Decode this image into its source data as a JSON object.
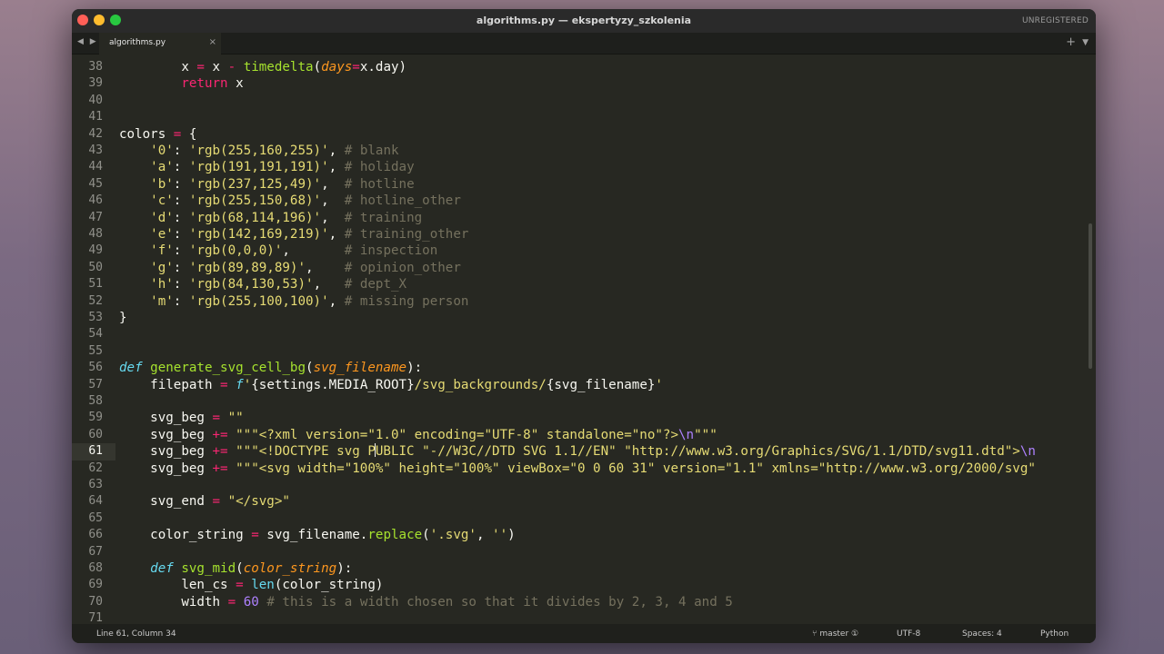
{
  "window": {
    "title": "algorithms.py — ekspertyzy_szkolenia",
    "unregistered": "UNREGISTERED"
  },
  "tabs": [
    {
      "label": "algorithms.py",
      "active": true
    }
  ],
  "tabbar": {
    "nav": "◀ ▶",
    "close": "×",
    "plus": "+",
    "menu": "▼"
  },
  "status": {
    "position": "Line 61, Column 34",
    "branch": "master",
    "branch_badge": "①",
    "encoding": "UTF-8",
    "indent": "Spaces: 4",
    "syntax": "Python"
  },
  "editor": {
    "current_line": 61,
    "lines": [
      {
        "n": "38",
        "t": [
          [
            "",
            "        x "
          ],
          [
            "kw",
            "="
          ],
          [
            "",
            " x "
          ],
          [
            "kw",
            "-"
          ],
          [
            "",
            " "
          ],
          [
            "fn",
            "timedelta"
          ],
          [
            "",
            "("
          ],
          [
            "prm",
            "days"
          ],
          [
            "kw",
            "="
          ],
          [
            "",
            "x.day)"
          ]
        ]
      },
      {
        "n": "39",
        "t": [
          [
            "",
            "        "
          ],
          [
            "kw",
            "return"
          ],
          [
            "",
            " x"
          ]
        ]
      },
      {
        "n": "40",
        "t": []
      },
      {
        "n": "41",
        "t": []
      },
      {
        "n": "42",
        "t": [
          [
            "",
            "colors "
          ],
          [
            "kw",
            "="
          ],
          [
            "",
            " {"
          ]
        ]
      },
      {
        "n": "43",
        "t": [
          [
            "",
            "    "
          ],
          [
            "str",
            "'0'"
          ],
          [
            "",
            ": "
          ],
          [
            "str",
            "'rgb(255,160,255)'"
          ],
          [
            "",
            ", "
          ],
          [
            "cmt",
            "# blank"
          ]
        ]
      },
      {
        "n": "44",
        "t": [
          [
            "",
            "    "
          ],
          [
            "str",
            "'a'"
          ],
          [
            "",
            ": "
          ],
          [
            "str",
            "'rgb(191,191,191)'"
          ],
          [
            "",
            ", "
          ],
          [
            "cmt",
            "# holiday"
          ]
        ]
      },
      {
        "n": "45",
        "t": [
          [
            "",
            "    "
          ],
          [
            "str",
            "'b'"
          ],
          [
            "",
            ": "
          ],
          [
            "str",
            "'rgb(237,125,49)'"
          ],
          [
            "",
            ",  "
          ],
          [
            "cmt",
            "# hotline"
          ]
        ]
      },
      {
        "n": "46",
        "t": [
          [
            "",
            "    "
          ],
          [
            "str",
            "'c'"
          ],
          [
            "",
            ": "
          ],
          [
            "str",
            "'rgb(255,150,68)'"
          ],
          [
            "",
            ",  "
          ],
          [
            "cmt",
            "# hotline_other"
          ]
        ]
      },
      {
        "n": "47",
        "t": [
          [
            "",
            "    "
          ],
          [
            "str",
            "'d'"
          ],
          [
            "",
            ": "
          ],
          [
            "str",
            "'rgb(68,114,196)'"
          ],
          [
            "",
            ",  "
          ],
          [
            "cmt",
            "# training"
          ]
        ]
      },
      {
        "n": "48",
        "t": [
          [
            "",
            "    "
          ],
          [
            "str",
            "'e'"
          ],
          [
            "",
            ": "
          ],
          [
            "str",
            "'rgb(142,169,219)'"
          ],
          [
            "",
            ", "
          ],
          [
            "cmt",
            "# training_other"
          ]
        ]
      },
      {
        "n": "49",
        "t": [
          [
            "",
            "    "
          ],
          [
            "str",
            "'f'"
          ],
          [
            "",
            ": "
          ],
          [
            "str",
            "'rgb(0,0,0)'"
          ],
          [
            "",
            ",       "
          ],
          [
            "cmt",
            "# inspection"
          ]
        ]
      },
      {
        "n": "50",
        "t": [
          [
            "",
            "    "
          ],
          [
            "str",
            "'g'"
          ],
          [
            "",
            ": "
          ],
          [
            "str",
            "'rgb(89,89,89)'"
          ],
          [
            "",
            ",    "
          ],
          [
            "cmt",
            "# opinion_other"
          ]
        ]
      },
      {
        "n": "51",
        "t": [
          [
            "",
            "    "
          ],
          [
            "str",
            "'h'"
          ],
          [
            "",
            ": "
          ],
          [
            "str",
            "'rgb(84,130,53)'"
          ],
          [
            "",
            ",   "
          ],
          [
            "cmt",
            "# dept_X"
          ]
        ]
      },
      {
        "n": "52",
        "t": [
          [
            "",
            "    "
          ],
          [
            "str",
            "'m'"
          ],
          [
            "",
            ": "
          ],
          [
            "str",
            "'rgb(255,100,100)'"
          ],
          [
            "",
            ", "
          ],
          [
            "cmt",
            "# missing person"
          ]
        ]
      },
      {
        "n": "53",
        "t": [
          [
            "",
            "}"
          ]
        ]
      },
      {
        "n": "54",
        "t": []
      },
      {
        "n": "55",
        "t": []
      },
      {
        "n": "56",
        "t": [
          [
            "df",
            "def"
          ],
          [
            "",
            " "
          ],
          [
            "fn",
            "generate_svg_cell_bg"
          ],
          [
            "",
            "("
          ],
          [
            "prm",
            "svg_filename"
          ],
          [
            "",
            "):"
          ]
        ]
      },
      {
        "n": "57",
        "t": [
          [
            "",
            "    filepath "
          ],
          [
            "kw",
            "="
          ],
          [
            "",
            " "
          ],
          [
            "df",
            "f"
          ],
          [
            "str",
            "'"
          ],
          [
            "",
            "{settings.MEDIA_ROOT}"
          ],
          [
            "str",
            "/svg_backgrounds/"
          ],
          [
            "",
            "{svg_filename}"
          ],
          [
            "str",
            "'"
          ]
        ]
      },
      {
        "n": "58",
        "t": []
      },
      {
        "n": "59",
        "t": [
          [
            "",
            "    svg_beg "
          ],
          [
            "kw",
            "="
          ],
          [
            "",
            " "
          ],
          [
            "str",
            "\"\""
          ]
        ]
      },
      {
        "n": "60",
        "t": [
          [
            "",
            "    svg_beg "
          ],
          [
            "kw",
            "+="
          ],
          [
            "",
            " "
          ],
          [
            "str",
            "\"\"\"<?xml version=\"1.0\" encoding=\"UTF-8\" standalone=\"no\"?>"
          ],
          [
            "num",
            "\\n"
          ],
          [
            "str",
            "\"\"\""
          ]
        ]
      },
      {
        "n": "61",
        "t": [
          [
            "",
            "    svg_beg "
          ],
          [
            "kw",
            "+="
          ],
          [
            "",
            " "
          ],
          [
            "str",
            "\"\"\"<!DOCTYPE svg P"
          ],
          [
            "cursor",
            ""
          ],
          [
            "str",
            "UBLIC \"-//W3C//DTD SVG 1.1//EN\" \"http://www.w3.org/Graphics/SVG/1.1/DTD/svg11.dtd\">"
          ],
          [
            "num",
            "\\n"
          ]
        ]
      },
      {
        "n": "62",
        "t": [
          [
            "",
            "    svg_beg "
          ],
          [
            "kw",
            "+="
          ],
          [
            "",
            " "
          ],
          [
            "str",
            "\"\"\"<svg width=\"100%\" height=\"100%\" viewBox=\"0 0 60 31\" version=\"1.1\" xmlns=\"http://www.w3.org/2000/svg\""
          ]
        ]
      },
      {
        "n": "63",
        "t": []
      },
      {
        "n": "64",
        "t": [
          [
            "",
            "    svg_end "
          ],
          [
            "kw",
            "="
          ],
          [
            "",
            " "
          ],
          [
            "str",
            "\"</svg>\""
          ]
        ]
      },
      {
        "n": "65",
        "t": []
      },
      {
        "n": "66",
        "t": [
          [
            "",
            "    color_string "
          ],
          [
            "kw",
            "="
          ],
          [
            "",
            " svg_filename."
          ],
          [
            "fn",
            "replace"
          ],
          [
            "",
            "("
          ],
          [
            "str",
            "'.svg'"
          ],
          [
            "",
            ", "
          ],
          [
            "str",
            "''"
          ],
          [
            "",
            ")"
          ]
        ]
      },
      {
        "n": "67",
        "t": []
      },
      {
        "n": "68",
        "t": [
          [
            "",
            "    "
          ],
          [
            "df",
            "def"
          ],
          [
            "",
            " "
          ],
          [
            "fn",
            "svg_mid"
          ],
          [
            "",
            "("
          ],
          [
            "prm",
            "color_string"
          ],
          [
            "",
            "):"
          ]
        ]
      },
      {
        "n": "69",
        "t": [
          [
            "",
            "        len_cs "
          ],
          [
            "kw",
            "="
          ],
          [
            "",
            " "
          ],
          [
            "bi",
            "len"
          ],
          [
            "",
            "(color_string)"
          ]
        ]
      },
      {
        "n": "70",
        "t": [
          [
            "",
            "        width "
          ],
          [
            "kw",
            "="
          ],
          [
            "",
            " "
          ],
          [
            "num",
            "60"
          ],
          [
            "",
            " "
          ],
          [
            "cmt",
            "# this is a width chosen so that it divides by 2, 3, 4 and 5"
          ]
        ]
      },
      {
        "n": "71",
        "t": []
      }
    ]
  }
}
